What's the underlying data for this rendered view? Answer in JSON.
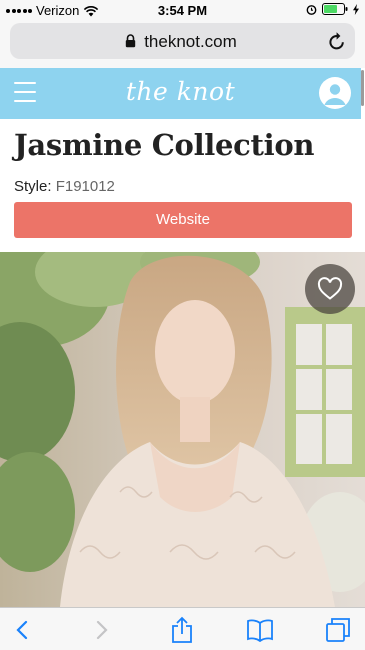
{
  "status_bar": {
    "carrier": "Verizon",
    "time": "3:54 PM"
  },
  "browser": {
    "url": "theknot.com"
  },
  "site_header": {
    "logo_text": "the knot"
  },
  "product": {
    "title": "Jasmine Collection",
    "style_label": "Style:",
    "style_value": "F191012",
    "website_button": "Website"
  },
  "colors": {
    "header": "#8ed3ef",
    "button": "#ec7468",
    "ios_blue": "#1a82fb"
  },
  "icons": [
    "wifi-icon",
    "lock-icon",
    "reload-icon",
    "menu-icon",
    "account-icon",
    "heart-icon",
    "back-icon",
    "forward-icon",
    "share-icon",
    "bookmarks-icon",
    "tabs-icon",
    "alarm-icon",
    "battery-icon"
  ]
}
